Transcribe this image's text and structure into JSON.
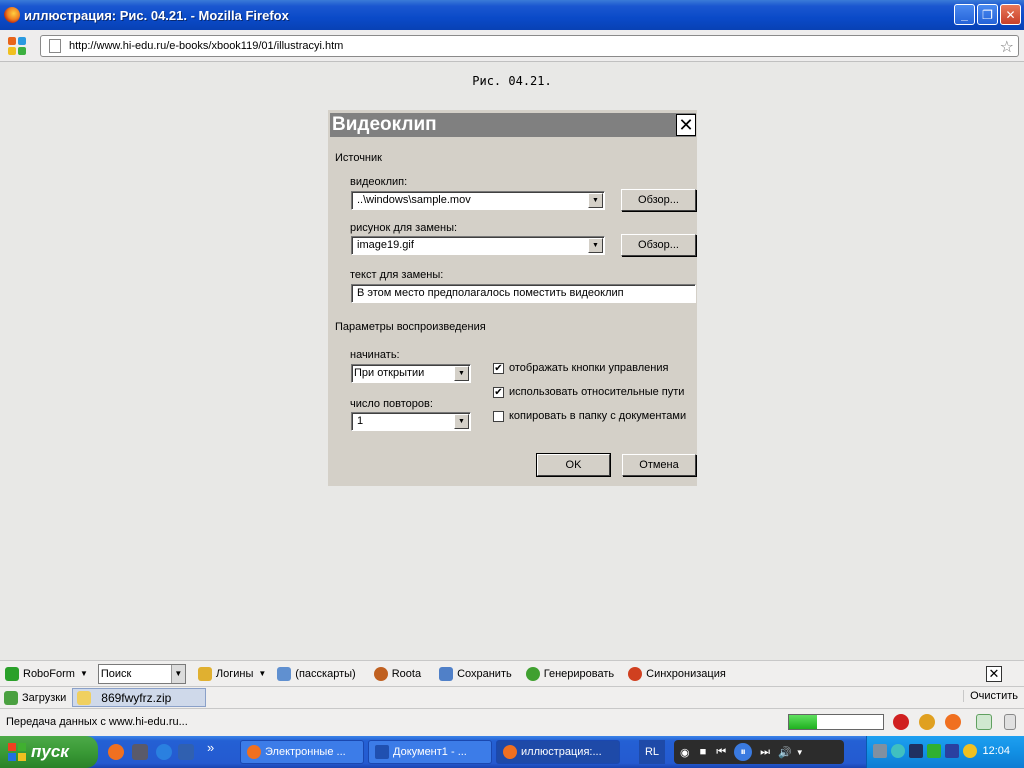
{
  "window": {
    "title": "иллюстрация: Рис. 04.21. - Mozilla Firefox",
    "minimize": "_",
    "restore": "❐",
    "close": "✕"
  },
  "nav": {
    "url": "http://www.hi-edu.ru/e-books/xbook119/01/illustracyi.htm",
    "bookmark_icon": "star-icon"
  },
  "page": {
    "caption": "Рис. 04.21."
  },
  "dialog": {
    "title": "Видеоклип",
    "close": "✕",
    "source_group": "Источник",
    "videoclip_label": "видеоклип:",
    "videoclip_value": "..\\windows\\sample.mov",
    "browse1": "Обзор...",
    "replacement_image_label": "рисунок для замены:",
    "replacement_image_value": "image19.gif",
    "browse2": "Обзор...",
    "replacement_text_label": "текст для замены:",
    "replacement_text_value": "В этом место предполагалось поместить видеоклип",
    "playback_group": "Параметры воспроизведения",
    "start_label": "начинать:",
    "start_value": "При открытии",
    "repeat_label": "число повторов:",
    "repeat_value": "1",
    "checkbox1_label": "отображать кнопки управления",
    "checkbox1_checked": true,
    "checkbox2_label": "использовать относительные пути",
    "checkbox2_checked": true,
    "checkbox3_label": "копировать в папку с документами",
    "checkbox3_checked": false,
    "ok": "OK",
    "cancel": "Отмена"
  },
  "roboform": {
    "brand": "RoboForm",
    "search_value": "Поиск",
    "logins": "Логины",
    "passcards": "(пасскарты)",
    "roota": "Roota",
    "save": "Сохранить",
    "generate": "Генерировать",
    "sync": "Синхронизация",
    "close": "✕"
  },
  "downloads": {
    "label": "Загрузки",
    "file": "869fwyfrz.zip",
    "clear": "Очистить"
  },
  "status": {
    "text": "Передача данных с www.hi-edu.ru...",
    "progress": 0.3
  },
  "taskbar": {
    "start": "пуск",
    "overflow": "»",
    "tasks": [
      {
        "label": "Электронные ...",
        "active": false
      },
      {
        "label": "Документ1 - ...",
        "active": false
      },
      {
        "label": "иллюстрация:...",
        "active": true
      }
    ],
    "lang": "RL",
    "clock": "12:04"
  },
  "colors": {
    "titlebar": "#0a4ac8",
    "dialog_bg": "#d4d0c8",
    "taskbar": "#245ad0",
    "start": "#3a9a36",
    "tray": "#1290e4"
  }
}
